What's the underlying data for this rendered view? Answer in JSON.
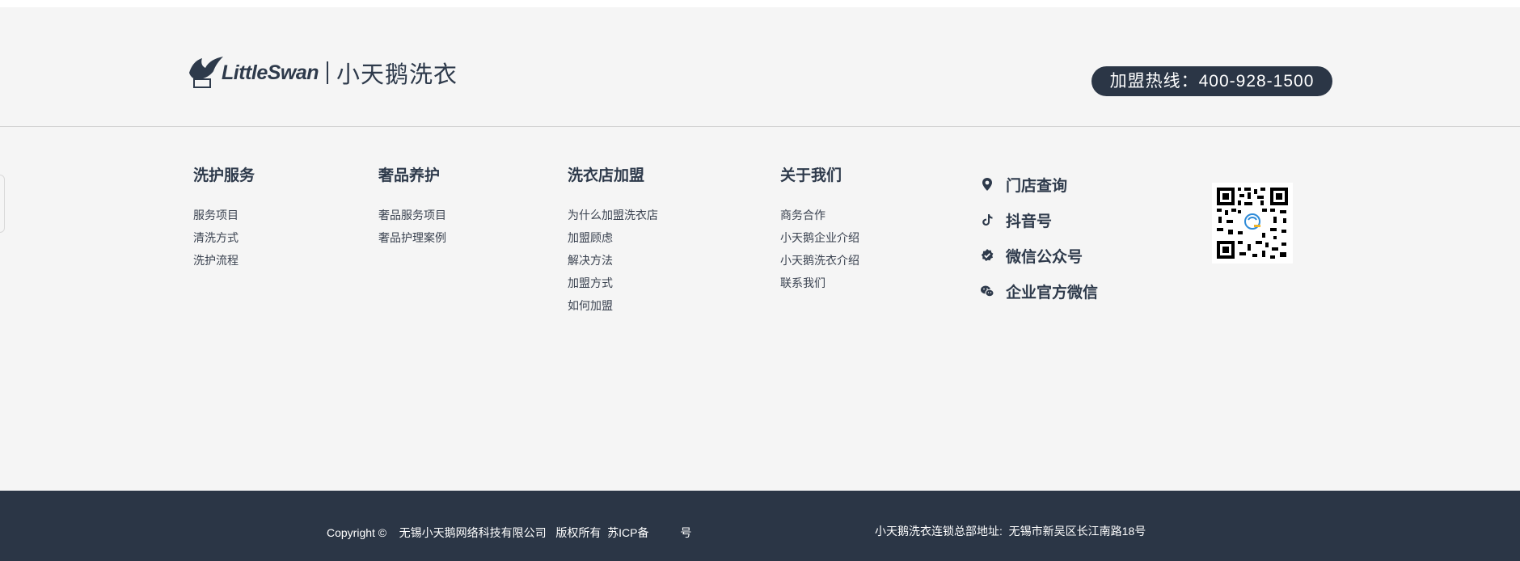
{
  "header": {
    "logo_en": "LittleSwan",
    "logo_cn": "小天鹅洗衣",
    "hotline": "加盟热线：400-928-1500"
  },
  "columns": [
    {
      "title": "洗护服务",
      "links": [
        "服务项目",
        "清洗方式",
        "洗护流程"
      ]
    },
    {
      "title": "奢品养护",
      "links": [
        "奢品服务项目",
        "奢品护理案例"
      ]
    },
    {
      "title": "洗衣店加盟",
      "links": [
        "为什么加盟洗衣店",
        "加盟顾虑",
        "解决方法",
        "加盟方式",
        "如何加盟"
      ]
    },
    {
      "title": "关于我们",
      "links": [
        "商务合作",
        "小天鹅企业介绍",
        "小天鹅洗衣介绍",
        "联系我们"
      ]
    }
  ],
  "social": [
    {
      "label": "门店查询",
      "icon": "location-pin-icon"
    },
    {
      "label": "抖音号",
      "icon": "tiktok-icon"
    },
    {
      "label": "微信公众号",
      "icon": "verified-badge-icon"
    },
    {
      "label": "企业官方微信",
      "icon": "wechat-icon"
    }
  ],
  "footer": {
    "copyright": "Copyright ©    无锡小天鹅网络科技有限公司   版权所有  苏ICP备          号",
    "address": "小天鹅洗衣连锁总部地址:  无锡市新吴区长江南路18号"
  },
  "colors": {
    "primary": "#2b3646",
    "background": "#f5f5f5"
  }
}
